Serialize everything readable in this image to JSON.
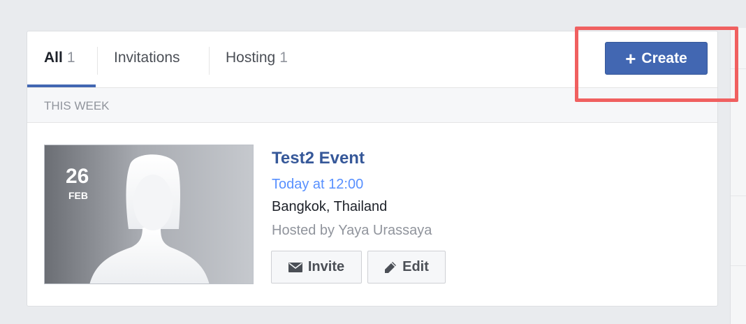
{
  "tabs": {
    "all_label": "All",
    "all_count": "1",
    "invitations_label": "Invitations",
    "hosting_label": "Hosting",
    "hosting_count": "1"
  },
  "toolbar": {
    "create_icon": "+",
    "create_label": "Create"
  },
  "section": {
    "header": "THIS WEEK"
  },
  "event": {
    "day": "26",
    "month": "FEB",
    "title": "Test2 Event",
    "time": "Today at 12:00",
    "location": "Bangkok, Thailand",
    "host": "Hosted by Yaya Urassaya",
    "invite_label": "Invite",
    "edit_label": "Edit",
    "invite_icon": "envelope-icon",
    "edit_icon": "pencil-icon"
  },
  "colors": {
    "accent": "#4267b2",
    "link": "#365899",
    "time": "#5890ff",
    "highlight": "#f06060"
  }
}
